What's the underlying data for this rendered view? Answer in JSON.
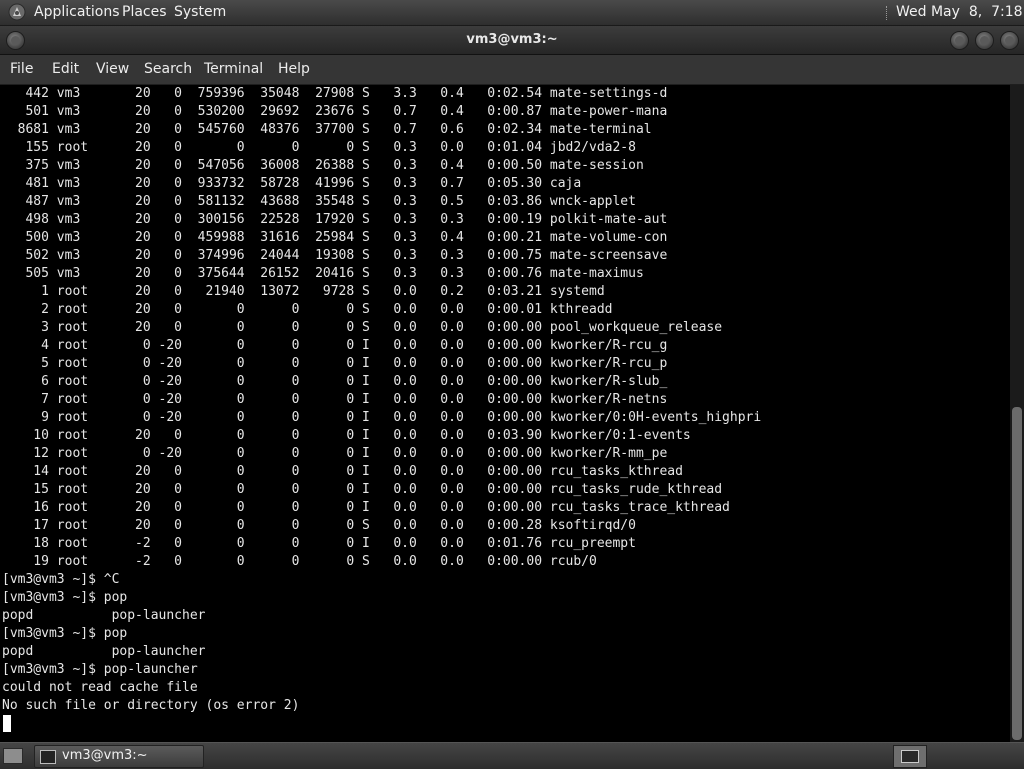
{
  "top_panel": {
    "menus": [
      "Applications",
      "Places",
      "System"
    ],
    "clock": "Wed May  8,  7:18 PM",
    "logo_icon": "distro-logo-icon"
  },
  "window": {
    "title": "vm3@vm3:~"
  },
  "menu_bar": [
    "File",
    "Edit",
    "View",
    "Search",
    "Terminal",
    "Help"
  ],
  "terminal": {
    "lines": [
      "   442 vm3       20   0  759396  35048  27908 S   3.3   0.4   0:02.54 mate-settings-d",
      "   501 vm3       20   0  530200  29692  23676 S   0.7   0.4   0:00.87 mate-power-mana",
      "  8681 vm3       20   0  545760  48376  37700 S   0.7   0.6   0:02.34 mate-terminal",
      "   155 root      20   0       0      0      0 S   0.3   0.0   0:01.04 jbd2/vda2-8",
      "   375 vm3       20   0  547056  36008  26388 S   0.3   0.4   0:00.50 mate-session",
      "   481 vm3       20   0  933732  58728  41996 S   0.3   0.7   0:05.30 caja",
      "   487 vm3       20   0  581132  43688  35548 S   0.3   0.5   0:03.86 wnck-applet",
      "   498 vm3       20   0  300156  22528  17920 S   0.3   0.3   0:00.19 polkit-mate-aut",
      "   500 vm3       20   0  459988  31616  25984 S   0.3   0.4   0:00.21 mate-volume-con",
      "   502 vm3       20   0  374996  24044  19308 S   0.3   0.3   0:00.75 mate-screensave",
      "   505 vm3       20   0  375644  26152  20416 S   0.3   0.3   0:00.76 mate-maximus",
      "     1 root      20   0   21940  13072   9728 S   0.0   0.2   0:03.21 systemd",
      "     2 root      20   0       0      0      0 S   0.0   0.0   0:00.01 kthreadd",
      "     3 root      20   0       0      0      0 S   0.0   0.0   0:00.00 pool_workqueue_release",
      "     4 root       0 -20       0      0      0 I   0.0   0.0   0:00.00 kworker/R-rcu_g",
      "     5 root       0 -20       0      0      0 I   0.0   0.0   0:00.00 kworker/R-rcu_p",
      "     6 root       0 -20       0      0      0 I   0.0   0.0   0:00.00 kworker/R-slub_",
      "     7 root       0 -20       0      0      0 I   0.0   0.0   0:00.00 kworker/R-netns",
      "     9 root       0 -20       0      0      0 I   0.0   0.0   0:00.00 kworker/0:0H-events_highpri",
      "    10 root      20   0       0      0      0 I   0.0   0.0   0:03.90 kworker/0:1-events",
      "    12 root       0 -20       0      0      0 I   0.0   0.0   0:00.00 kworker/R-mm_pe",
      "    14 root      20   0       0      0      0 I   0.0   0.0   0:00.00 rcu_tasks_kthread",
      "    15 root      20   0       0      0      0 I   0.0   0.0   0:00.00 rcu_tasks_rude_kthread",
      "    16 root      20   0       0      0      0 I   0.0   0.0   0:00.00 rcu_tasks_trace_kthread",
      "    17 root      20   0       0      0      0 S   0.0   0.0   0:00.28 ksoftirqd/0",
      "    18 root      -2   0       0      0      0 I   0.0   0.0   0:01.76 rcu_preempt",
      "    19 root      -2   0       0      0      0 S   0.0   0.0   0:00.00 rcub/0",
      "[vm3@vm3 ~]$ ^C",
      "[vm3@vm3 ~]$ pop",
      "popd          pop-launcher",
      "[vm3@vm3 ~]$ pop",
      "popd          pop-launcher",
      "[vm3@vm3 ~]$ pop-launcher",
      "could not read cache file",
      "No such file or directory (os error 2)"
    ]
  },
  "taskbar": {
    "task_label": "vm3@vm3:~"
  }
}
